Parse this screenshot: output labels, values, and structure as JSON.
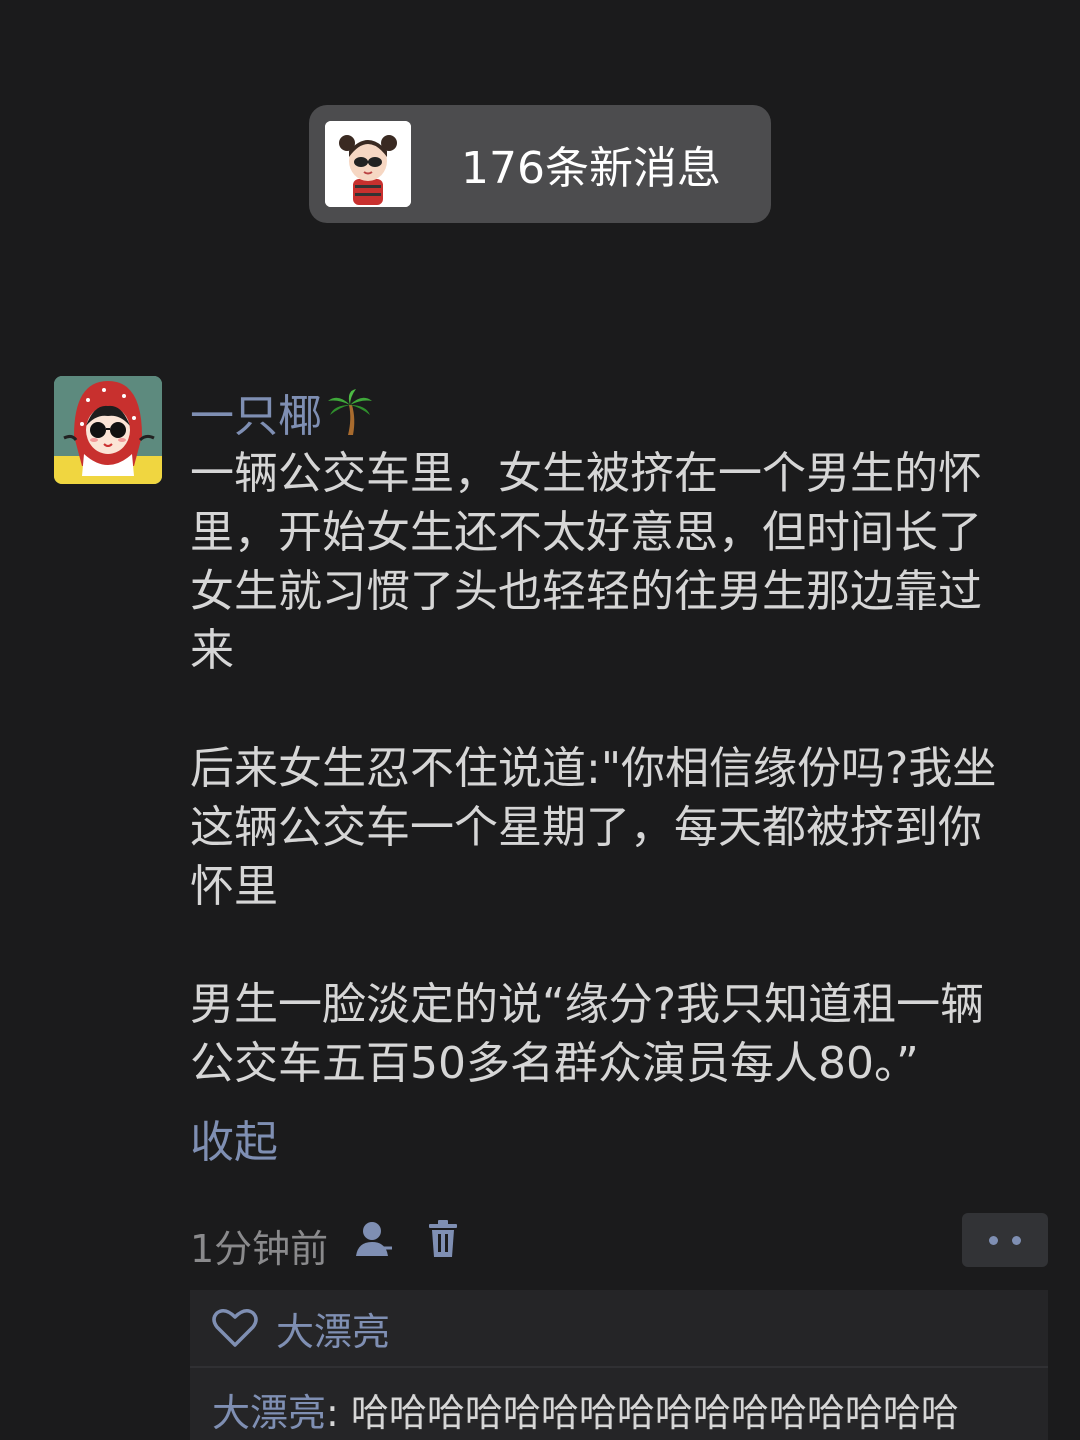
{
  "notice": {
    "text": "176条新消息",
    "avatar_icon": "cartoon-girl-sunglasses-avatar"
  },
  "post": {
    "author": "一只椰",
    "author_emoji_icon": "palm-tree-icon",
    "avatar_icon": "cartoon-girl-red-hood-avatar",
    "paragraphs": [
      "一辆公交车里，女生被挤在一个男生的怀\n里，开始女生还不太好意思，但时间长了\n女生就习惯了头也轻轻的往男生那边靠过\n来",
      "后来女生忍不住说道:\"你相信缘份吗?我坐\n这辆公交车一个星期了，每天都被挤到你\n怀里",
      "男生一脸淡定的说“缘分?我只知道租一辆\n公交车五百50多名群众演员每人80。”"
    ],
    "collapse_label": "收起",
    "time": "1分钟前"
  },
  "actions": {
    "privacy_icon": "person-icon",
    "delete_icon": "trash-icon",
    "more_icon": "more-dots-icon"
  },
  "likes": {
    "icon": "heart-outline-icon",
    "names": "大漂亮"
  },
  "comments": [
    {
      "user": "大漂亮",
      "separator": ": ",
      "text": "哈哈哈哈哈哈哈哈哈哈哈哈哈哈哈哈"
    }
  ],
  "colors": {
    "background": "#1b1b1c",
    "link": "#7f8fb3",
    "text": "#d6d6d6"
  }
}
